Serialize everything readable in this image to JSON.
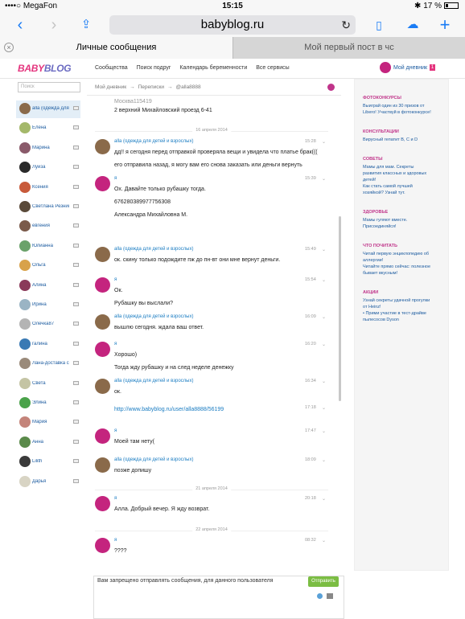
{
  "status": {
    "carrier": "••••○ MegaFon",
    "time": "15:15",
    "battery": "17 %"
  },
  "browser": {
    "url": "babyblog.ru",
    "reload_icon": "reload-icon",
    "tabs": [
      {
        "label": "Личные сообщения",
        "active": true
      },
      {
        "label": "Мой первый пост в чс",
        "active": false
      }
    ]
  },
  "site": {
    "logo": {
      "part1": "BABY",
      "part2": "BLOG"
    },
    "nav": [
      "Сообщества",
      "Поиск подруг",
      "Календарь беременности",
      "Все сервисы"
    ],
    "my_diary": "Мой дневник",
    "badge": "1"
  },
  "contacts": {
    "search_placeholder": "Поиск",
    "items": [
      {
        "name": "alla (одежда для детей и взрослых)",
        "color": "#8a6a4a",
        "active": true
      },
      {
        "name": "Елена",
        "color": "#a4b86a"
      },
      {
        "name": "Марина",
        "color": "#8a5a6a"
      },
      {
        "name": "Луиза",
        "color": "#2a2a2a"
      },
      {
        "name": "Ксения",
        "color": "#c85a3a"
      },
      {
        "name": "Светлана Резник",
        "color": "#5a4a3a"
      },
      {
        "name": "евгения",
        "color": "#7a5a4a"
      },
      {
        "name": "Юлианна",
        "color": "#6aa26a"
      },
      {
        "name": "Ольга",
        "color": "#d8a24a"
      },
      {
        "name": "Алина",
        "color": "#8a3a5a"
      },
      {
        "name": "Ирина",
        "color": "#9ab4c4"
      },
      {
        "name": "Олечка87",
        "color": "#b4b4b4"
      },
      {
        "name": "галина",
        "color": "#3a7ab4"
      },
      {
        "name": "Лана-доставка с",
        "color": "#9a8a7a"
      },
      {
        "name": "Света",
        "color": "#c4c4a4"
      },
      {
        "name": "Элина",
        "color": "#4aa24a"
      },
      {
        "name": "Мария",
        "color": "#c4847a"
      },
      {
        "name": "Анна",
        "color": "#5a8a4a"
      },
      {
        "name": "Lilith",
        "color": "#3a3a3a"
      },
      {
        "name": "Дарья",
        "color": "#d8d4c4"
      }
    ]
  },
  "conversation": {
    "breadcrumbs": [
      "Мой дневник",
      "Переписки",
      "@alla8888"
    ],
    "first_msg": {
      "line1": "Москва115419",
      "line2": "2 верхний Михайловский проезд 6-41"
    },
    "date1": "16 апреля 2014",
    "date2": "21 апреля 2014",
    "date3": "22 апреля 2014",
    "messages": [
      {
        "author": "alla (одежда для детей и взрослых)",
        "time": "15:28",
        "lines": [
          "дд!! я сегодня перед отправкой проверяла вещи и увидела что платье брак(((",
          "его отправила назад, я могу вам его снова заказать или деньги вернуть"
        ]
      },
      {
        "author": "я",
        "time": "15:39",
        "lines": [
          "Ох. Давайте только рубашку тогда.",
          "676280389977756308",
          "Александра Михайловна М."
        ]
      },
      {
        "author": "alla (одежда для детей и взрослых)",
        "time": "15:49",
        "lines": [
          "ок. скину только подождите пж до пн-вт они мне вернут деньги."
        ]
      },
      {
        "author": "я",
        "time": "15:54",
        "lines": [
          "Ок.",
          "Рубашку вы выслали?"
        ]
      },
      {
        "author": "alla (одежда для детей и взрослых)",
        "time": "16:09",
        "lines": [
          "вышлю сегодня. ждала ваш ответ."
        ]
      },
      {
        "author": "я",
        "time": "16:20",
        "lines": [
          "Хорошо)",
          "Тогда жду рубашку и на след неделе денежку"
        ]
      },
      {
        "author": "alla (одежда для детей и взрослых)",
        "time": "16:34",
        "lines": [
          "ок."
        ]
      },
      {
        "author": "",
        "time": "17:18",
        "lines": [
          "http://www.babyblog.ru/user/alla8888/56199"
        ]
      },
      {
        "author": "я",
        "time": "17:47",
        "lines": [
          "Моей там нету("
        ]
      },
      {
        "author": "alla (одежда для детей и взрослых)",
        "time": "18:09",
        "lines": [
          "позже допишу"
        ]
      },
      {
        "author": "я",
        "time": "20:18",
        "lines": [
          "Алла. Добрый вечер. Я жду возврат."
        ]
      },
      {
        "author": "я",
        "time": "08:32",
        "lines": [
          "????"
        ]
      }
    ],
    "reply_notice": "Вам запрещено отправлять сообщения, для данного пользователя",
    "send_label": "Отправить"
  },
  "sidebar": {
    "sections": [
      {
        "title": "ФОТОКОНКУРСЫ",
        "links": [
          "Выиграй один из 30 призов от",
          "Libero! Участвуй в фотоконкурсе!"
        ]
      },
      {
        "title": "КОНСУЛЬТАЦИИ",
        "links": [
          "Вирусный гепатит B, C и D"
        ]
      },
      {
        "title": "СОВЕТЫ",
        "links": [
          "Мамы для мам. Секреты",
          "развития классных и здоровых",
          "детей!",
          "Как стать самой лучшей",
          "хозяйкой? Узнай тут."
        ]
      },
      {
        "title": "ЗДОРОВЬЕ",
        "links": [
          "Мамы гуляют вместе.",
          "Присоединяйся!"
        ]
      },
      {
        "title": "ЧТО ПОЧИТАТЬ",
        "links": [
          "Читай первую энциклопедию об",
          "аллергии!",
          "Читайте прямо сейчас: полезное",
          "бывает вкусным!"
        ]
      },
      {
        "title": "АКЦИИ",
        "links": [
          "Узнай секреты удачной прогулки",
          "от Heinz!",
          "• Прими участие в тест-драйве",
          "пылесосов Dyson"
        ]
      }
    ]
  },
  "colors": {
    "brand_pink": "#e4357e",
    "link_blue": "#1a7cc2",
    "ios_blue": "#1a7cf5",
    "send_green": "#7bbd43"
  }
}
